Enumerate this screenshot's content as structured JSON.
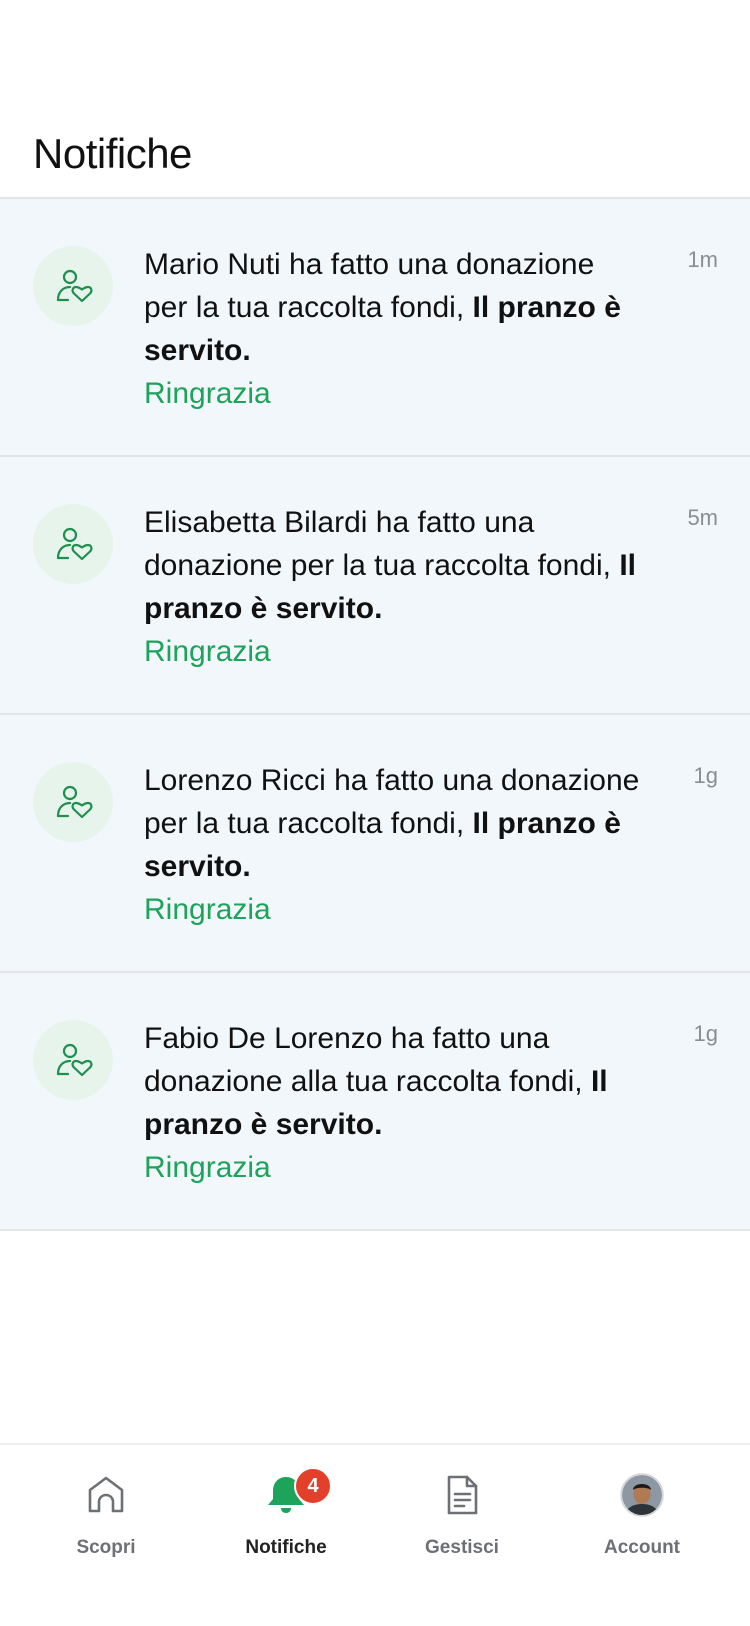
{
  "header": {
    "title": "Notifiche"
  },
  "notifications": [
    {
      "text": "Mario Nuti ha fatto una donazione per la tua raccolta fondi, ",
      "bold": "Il pranzo è servito.",
      "action": "Ringrazia",
      "time": "1m"
    },
    {
      "text": "Elisabetta Bilardi ha fatto una donazione per la tua raccolta fondi, ",
      "bold": "Il pranzo è servito.",
      "action": "Ringrazia",
      "time": "5m"
    },
    {
      "text": "Lorenzo Ricci ha fatto una donazione per la tua raccolta fondi, ",
      "bold": "Il pranzo è servito.",
      "action": "Ringrazia",
      "time": "1g"
    },
    {
      "text": "Fabio De Lorenzo ha fatto una donazione alla tua raccolta fondi, ",
      "bold": "Il pranzo è servito.",
      "action": "Ringrazia",
      "time": "1g"
    }
  ],
  "tabbar": {
    "tabs": [
      {
        "label": "Scopri",
        "icon": "home-icon"
      },
      {
        "label": "Notifiche",
        "icon": "bell-icon",
        "badge": "4",
        "active": true
      },
      {
        "label": "Gestisci",
        "icon": "document-icon"
      },
      {
        "label": "Account",
        "icon": "avatar"
      }
    ]
  },
  "colors": {
    "accent": "#1ea35a",
    "badge": "#e2402a",
    "item_background": "#f2f7fc",
    "icon_circle": "#e6f4ec"
  }
}
